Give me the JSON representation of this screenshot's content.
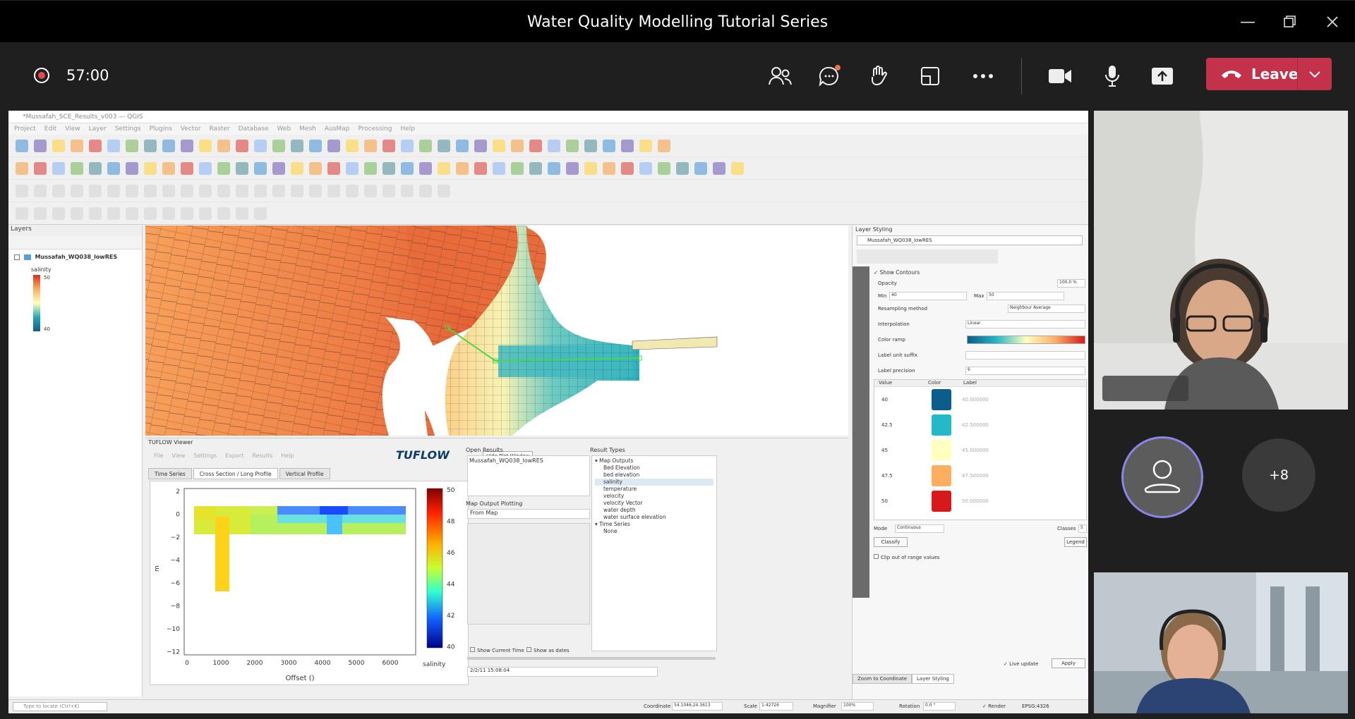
{
  "window": {
    "title": "Water Quality Modelling Tutorial Series"
  },
  "call": {
    "timer": "57:00",
    "leave_label": "Leave",
    "participants_more": "+8"
  },
  "qgis": {
    "layers_title": "Layers",
    "layer_name": "Mussafah_WQ038_lowRES",
    "legend_attr": "salinity",
    "legend_max": "50",
    "legend_min": "40",
    "tuflow": {
      "title": "TUFLOW Viewer",
      "menu": [
        "File",
        "View",
        "Settings",
        "Export",
        "Results",
        "Help"
      ],
      "logo": "TUFLOW",
      "hide_plot": "Hide Plot Window",
      "tabs": [
        "Time Series",
        "Cross Section / Long Profile",
        "Vertical Profile"
      ],
      "open_results_title": "Open Results",
      "open_results_item": "Mussafah_WQ038_lowRES",
      "map_output_plotting": "Map Output Plotting",
      "from_map": "From Map",
      "result_types_title": "Result Types",
      "result_types": [
        "Map Outputs",
        "Bed Elevation",
        "bed elevation",
        "salinity",
        "temperature",
        "velocity",
        "velocity Vector",
        "water depth",
        "water surface elevation",
        "Time Series",
        "None"
      ],
      "show_current_time": "Show Current Time",
      "show_as_dates": "Show as dates",
      "timestep": "2/2/11 15:08:04",
      "plot": {
        "x_label": "Offset ()",
        "y_label": "m",
        "colorbar_label": "salinity",
        "x_ticks": [
          "0",
          "1000",
          "2000",
          "3000",
          "4000",
          "5000",
          "6000"
        ],
        "y_ticks": [
          "2",
          "0",
          "−2",
          "−4",
          "−6",
          "−8",
          "−10",
          "−12"
        ],
        "cbar_ticks": [
          "50",
          "48",
          "46",
          "44",
          "42",
          "40"
        ]
      }
    },
    "styling": {
      "title": "Layer Styling",
      "layer": "Mussafah_WQ038_lowRES",
      "show_contours": "Show Contours",
      "opacity": "Opacity",
      "opacity_value": "100.0 %",
      "min_label": "Min",
      "min_value": "40",
      "max_label": "Max",
      "max_value": "50",
      "resampling_label": "Resampling method",
      "resampling_value": "Neighbour Average",
      "interpolation_label": "Interpolation",
      "interpolation_value": "Linear",
      "color_ramp_label": "Color ramp",
      "label_unit_suffix": "Label unit suffix",
      "label_precision": "Label precision",
      "label_precision_value": "6",
      "table_headers": [
        "Value",
        "Color",
        "Label"
      ],
      "entries": [
        {
          "value": "40",
          "color": "#0b5d8a",
          "label": "40.000000"
        },
        {
          "value": "42.5",
          "color": "#25b8c9",
          "label": "42.500000"
        },
        {
          "value": "45",
          "color": "#ffffbf",
          "label": "45.000000"
        },
        {
          "value": "47.5",
          "color": "#fdae61",
          "label": "47.500000"
        },
        {
          "value": "50",
          "color": "#d7191c",
          "label": "50.000000"
        }
      ],
      "mode_label": "Mode",
      "mode_value": "Continuous",
      "classes_label": "Classes",
      "classes_value": "5",
      "classify": "Classify",
      "legend_btn": "Legend",
      "clip_out": "Clip out of range values",
      "live_update": "Live update",
      "apply": "Apply",
      "bottom_tabs": [
        "Zoom to Coordinate",
        "Layer Styling"
      ]
    },
    "status": {
      "locate_placeholder": "Type to locate (Ctrl+K)",
      "coordinate_label": "Coordinate",
      "coordinate_value": "54.1046,24.3613",
      "scale_label": "Scale",
      "scale_value": "1:42726",
      "magnifier_label": "Magnifier",
      "magnifier_value": "100%",
      "rotation_label": "Rotation",
      "rotation_value": "0.0 °",
      "render_label": "Render",
      "crs": "EPSG:4326"
    },
    "menu": [
      "Project",
      "Edit",
      "View",
      "Layer",
      "Settings",
      "Plugins",
      "Vector",
      "Raster",
      "Database",
      "Web",
      "Mesh",
      "AusMap",
      "Processing",
      "Help"
    ],
    "window_title": "*Mussafah_SCE_Results_v003 — QGIS"
  },
  "colors": {
    "leave": "#c4314b",
    "record": "#e5484d",
    "avatar_ring": "#8a86e8"
  }
}
